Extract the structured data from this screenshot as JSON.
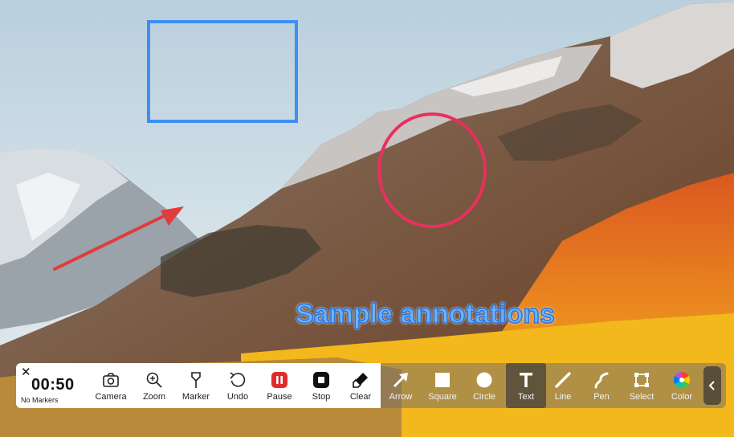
{
  "annotation_text": "Sample annotations",
  "recorder": {
    "close_icon": "close-icon",
    "timer": "00:50",
    "markers_label": "No Markers"
  },
  "tools_left": [
    {
      "label": "Camera",
      "icon": "camera-icon"
    },
    {
      "label": "Zoom",
      "icon": "zoom-in-icon"
    },
    {
      "label": "Marker",
      "icon": "marker-pin-icon"
    },
    {
      "label": "Undo",
      "icon": "undo-icon"
    },
    {
      "label": "Pause",
      "icon": "pause-icon"
    },
    {
      "label": "Stop",
      "icon": "stop-icon"
    },
    {
      "label": "Clear",
      "icon": "eraser-icon"
    }
  ],
  "tools_right": [
    {
      "label": "Arrow",
      "icon": "arrow-icon"
    },
    {
      "label": "Square",
      "icon": "square-icon"
    },
    {
      "label": "Circle",
      "icon": "circle-icon"
    },
    {
      "label": "Text",
      "icon": "text-icon",
      "active": true
    },
    {
      "label": "Line",
      "icon": "line-icon"
    },
    {
      "label": "Pen",
      "icon": "pen-icon"
    },
    {
      "label": "Select",
      "icon": "select-icon"
    },
    {
      "label": "Color",
      "icon": "color-wheel-icon"
    }
  ],
  "colors": {
    "annotation_blue": "#3d8ff0",
    "annotation_pink": "#e8305f",
    "annotation_red": "#e23b3b",
    "pause_red": "#e02c2c"
  }
}
